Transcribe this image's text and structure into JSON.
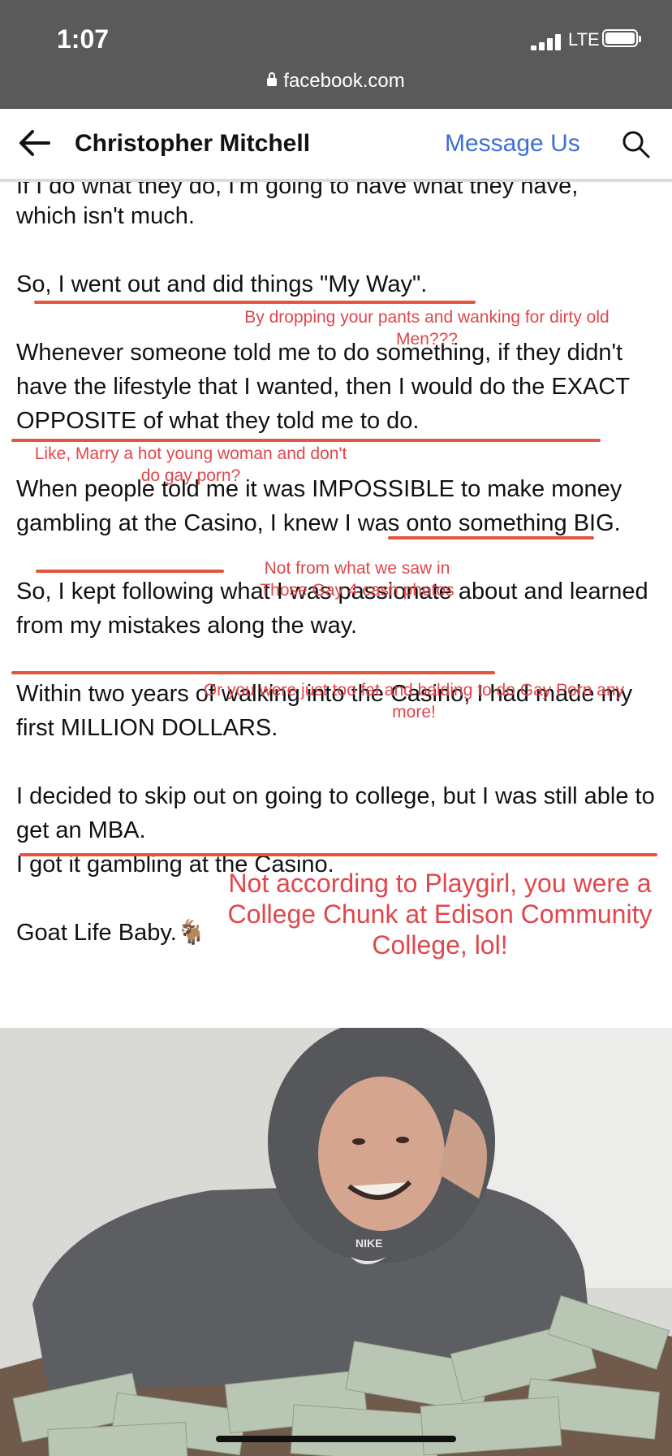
{
  "status": {
    "time": "1:07",
    "network": "LTE"
  },
  "browser": {
    "url": "facebook.com"
  },
  "header": {
    "page_name": "Christopher Mitchell",
    "message_button": "Message Us"
  },
  "post": {
    "cut_line": "If I do what they do, I'm going to have what they have,",
    "p1": "which isn't much.",
    "p2": "So, I went out and did things \"My Way\".",
    "p3": "Whenever someone told me to do something, if they didn't have the lifestyle that I wanted, then I would do the EXACT OPPOSITE of what they told me to do.",
    "p4": "When people told me it was IMPOSSIBLE to make money gambling at the Casino, I knew I was onto something BIG.",
    "p5": "So, I kept following what I was passionate about and learned from my mistakes along the way.",
    "p6": "Within two years of walking into the Casino, I had made my first MILLION DOLLARS.",
    "p7": "I decided to skip out on going to college, but I was still able to get an MBA.",
    "p8": "I got it gambling at the Casino.",
    "p9": "Goat Life Baby.",
    "p9_emoji": "🐐"
  },
  "annotations": {
    "a1": "By dropping your pants and wanking for dirty old Men???",
    "a2": "Like, Marry a hot young woman and don't do gay porn?",
    "a3": "Not from what we saw in Those Gay 4 cash photos",
    "a4": "Or you were just too fat and balding to do Gay Porn any more!",
    "a5": "Not according to Playgirl, you were a College Chunk at Edison Community College, lol!"
  },
  "photo": {
    "shirt_logo": "NIKE"
  },
  "colors": {
    "annotation": "#e0474c",
    "underline": "#e2553e",
    "link": "#3b6fd6",
    "statusbar": "#5a5a5a"
  }
}
